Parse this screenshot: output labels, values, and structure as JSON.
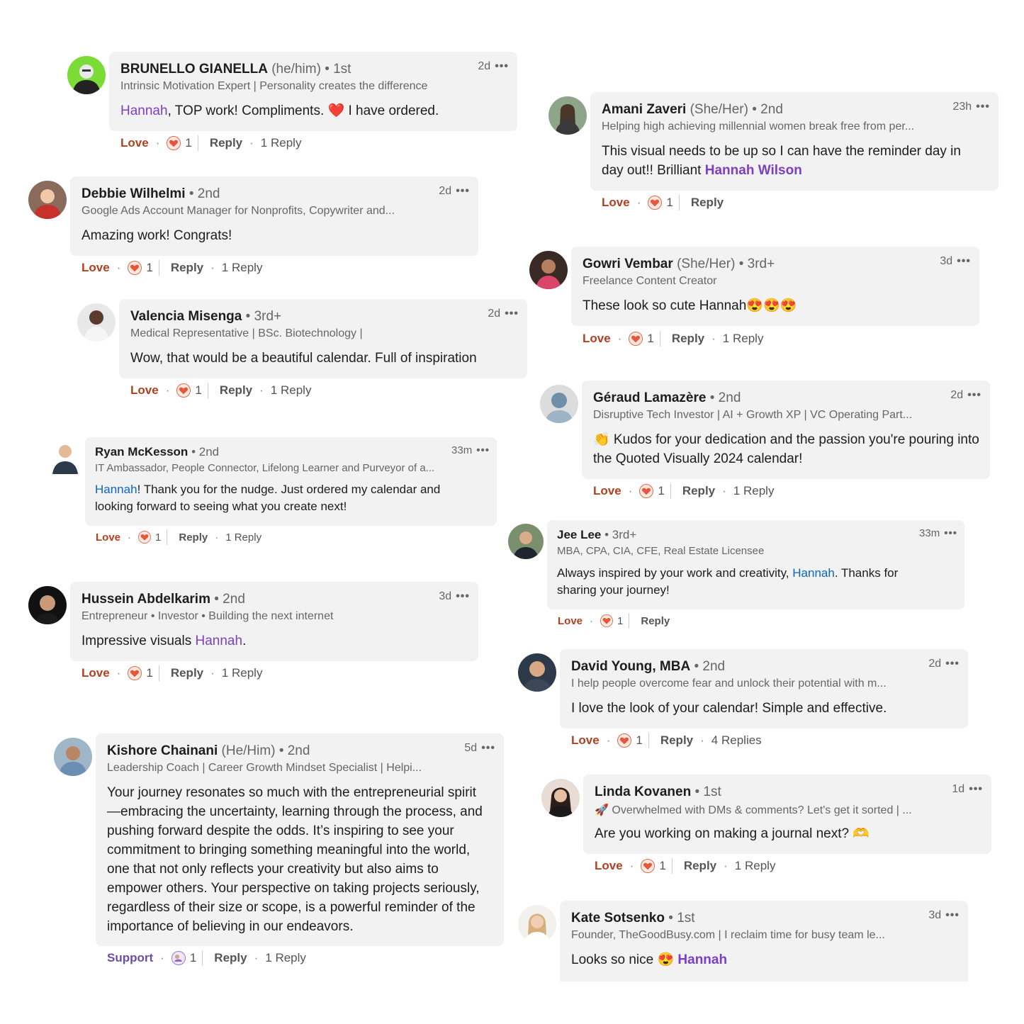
{
  "comments": [
    {
      "name": "BRUNELLO GIANELLA",
      "pronouns": "(he/him)",
      "degree": "• 1st",
      "headline": "Intrinsic Motivation Expert | Personality creates the difference",
      "time": "2d",
      "mention": "Hannah",
      "text": ", TOP work! Compliments. ❤️ I have ordered.",
      "react": "Love",
      "count": "1",
      "reply": "Reply",
      "replies": "1 Reply"
    },
    {
      "name": "Debbie Wilhelmi",
      "degree": "• 2nd",
      "headline": "Google Ads Account Manager for Nonprofits, Copywriter and...",
      "time": "2d",
      "text": "Amazing work! Congrats!",
      "react": "Love",
      "count": "1",
      "reply": "Reply",
      "replies": "1 Reply"
    },
    {
      "name": "Valencia Misenga",
      "degree": "• 3rd+",
      "headline": "Medical Representative | BSc. Biotechnology |",
      "time": "2d",
      "text": "Wow, that would be a beautiful calendar. Full of inspiration",
      "react": "Love",
      "count": "1",
      "reply": "Reply",
      "replies": "1 Reply"
    },
    {
      "name": "Ryan McKesson",
      "degree": "• 2nd",
      "headline": "IT Ambassador, People Connector, Lifelong Learner and Purveyor of a...",
      "time": "33m",
      "mention": "Hannah",
      "text": "! Thank you for the nudge. Just ordered my calendar and looking forward to seeing what you create next!",
      "react": "Love",
      "count": "1",
      "reply": "Reply",
      "replies": "1 Reply"
    },
    {
      "name": "Hussein Abdelkarim",
      "degree": "• 2nd",
      "headline": "Entrepreneur • Investor • Building the next internet",
      "time": "3d",
      "text_pre": "Impressive visuals ",
      "mention": "Hannah",
      "text": ".",
      "react": "Love",
      "count": "1",
      "reply": "Reply",
      "replies": "1 Reply"
    },
    {
      "name": "Kishore Chainani",
      "pronouns": "(He/Him)",
      "degree": "• 2nd",
      "headline": "Leadership Coach | Career Growth Mindset Specialist | Helpi...",
      "time": "5d",
      "text": "Your journey resonates so much with the entrepreneurial spirit —embracing the uncertainty, learning through the process, and pushing forward despite the odds. It’s inspiring to see your commitment to bringing something meaningful into the world, one that not only reflects your creativity but also aims to empower others. Your perspective on taking projects seriously, regardless of their size or scope, is a powerful reminder of the importance of believing in our endeavors.",
      "react": "Support",
      "count": "1",
      "reply": "Reply",
      "replies": "1 Reply"
    },
    {
      "name": "Amani Zaveri",
      "pronouns": "(She/Her)",
      "degree": "• 2nd",
      "headline": "Helping high achieving millennial women break free from per...",
      "time": "23h",
      "text_pre": "This visual needs to be up so I can have the reminder day in day out!! Brilliant ",
      "mention": "Hannah Wilson",
      "text": "",
      "react": "Love",
      "count": "1",
      "reply": "Reply"
    },
    {
      "name": "Gowri Vembar",
      "pronouns": "(She/Her)",
      "degree": "• 3rd+",
      "headline": "Freelance Content Creator",
      "time": "3d",
      "text": "These look so cute Hannah😍😍😍",
      "react": "Love",
      "count": "1",
      "reply": "Reply",
      "replies": "1 Reply"
    },
    {
      "name": "Géraud Lamazère",
      "degree": "• 2nd",
      "headline": "Disruptive Tech Investor | AI + Growth XP | VC Operating Part...",
      "time": "2d",
      "text": "👏 Kudos for your dedication and the passion you're pouring into the Quoted Visually 2024 calendar!",
      "react": "Love",
      "count": "1",
      "reply": "Reply",
      "replies": "1 Reply"
    },
    {
      "name": "Jee Lee",
      "degree": "• 3rd+",
      "headline": "MBA, CPA, CIA, CFE, Real Estate Licensee",
      "time": "33m",
      "text_pre": "Always inspired by your work and creativity, ",
      "mention": "Hannah",
      "text": ". Thanks for sharing your journey!",
      "react": "Love",
      "count": "1",
      "reply": "Reply"
    },
    {
      "name": "David Young, MBA",
      "degree": "• 2nd",
      "headline": "I help people overcome fear and unlock their potential with m...",
      "time": "2d",
      "text": "I love the look of your calendar! Simple and effective.",
      "react": "Love",
      "count": "1",
      "reply": "Reply",
      "replies": "4 Replies"
    },
    {
      "name": "Linda Kovanen",
      "degree": "• 1st",
      "headline": "🚀 Overwhelmed with DMs & comments? Let's get it sorted | ...",
      "time": "1d",
      "text": "Are you working on making a journal next? 🫶",
      "react": "Love",
      "count": "1",
      "reply": "Reply",
      "replies": "1 Reply"
    },
    {
      "name": "Kate Sotsenko",
      "degree": "• 1st",
      "headline": "Founder, TheGoodBusy.com | I reclaim time for busy team le...",
      "time": "3d",
      "text_pre": "Looks so nice 😍 ",
      "mention": "Hannah",
      "text": ""
    }
  ],
  "dots": "•••",
  "colors": {
    "bubble": "#f2f2f2",
    "love": "#b24020",
    "mention": "#7b3fc4",
    "mention_blue": "#0a66c2"
  }
}
